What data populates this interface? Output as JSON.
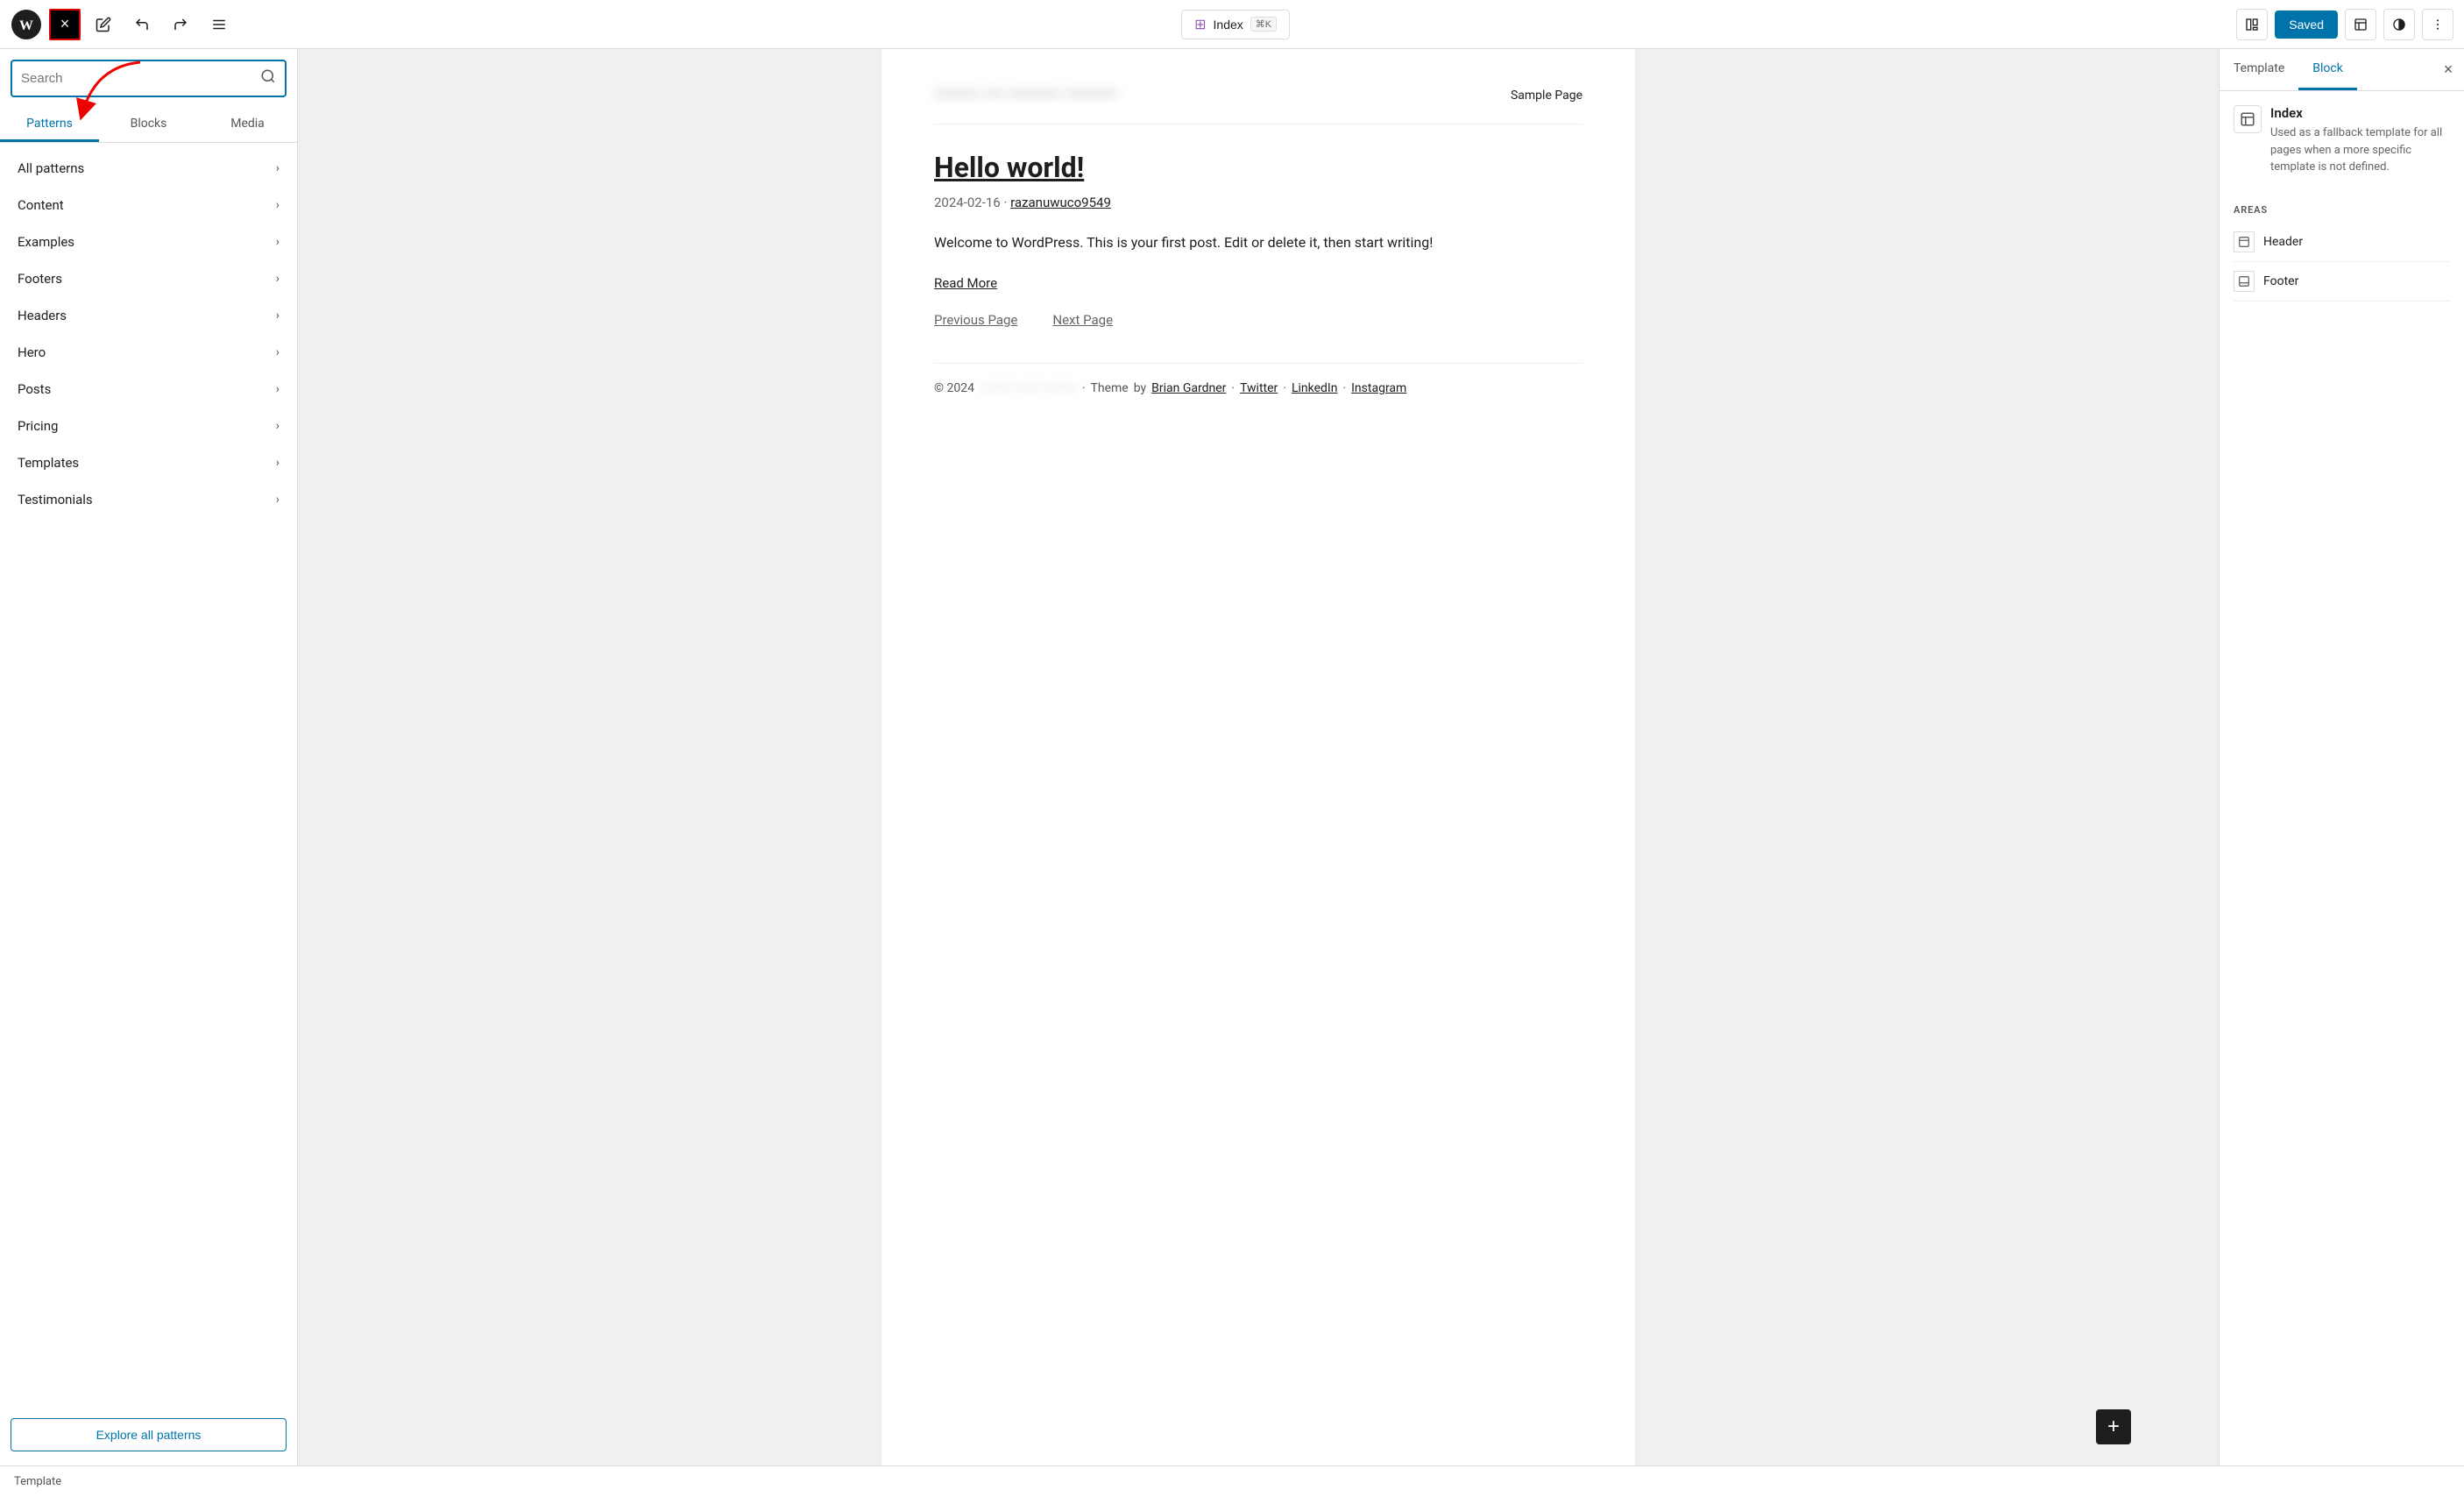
{
  "toolbar": {
    "close_label": "×",
    "command_palette_label": "Index",
    "command_palette_shortcut": "⌘K",
    "saved_label": "Saved",
    "undo_icon": "↩",
    "redo_icon": "↪",
    "list_view_icon": "≡"
  },
  "sidebar": {
    "search_placeholder": "Search",
    "tabs": [
      {
        "id": "patterns",
        "label": "Patterns"
      },
      {
        "id": "blocks",
        "label": "Blocks"
      },
      {
        "id": "media",
        "label": "Media"
      }
    ],
    "pattern_items": [
      {
        "label": "All patterns"
      },
      {
        "label": "Content"
      },
      {
        "label": "Examples"
      },
      {
        "label": "Footers"
      },
      {
        "label": "Headers"
      },
      {
        "label": "Hero"
      },
      {
        "label": "Posts"
      },
      {
        "label": "Pricing"
      },
      {
        "label": "Templates"
      },
      {
        "label": "Testimonials"
      }
    ],
    "explore_label": "Explore all patterns"
  },
  "content": {
    "page_header_blurred": "••••••••• ••• ••••••••• •••••••",
    "sample_page_label": "Sample Page",
    "post_title": "Hello world!",
    "post_meta_date": "2024-02-16",
    "post_meta_author": "razanuwuco9549",
    "post_body": "Welcome to WordPress. This is your first post. Edit or delete it, then start writing!",
    "read_more_label": "Read More",
    "prev_page_label": "Previous Page",
    "next_page_label": "Next Page",
    "footer_year": "© 2024",
    "footer_blurred": "••••••••• ••••••••• •••••••••",
    "footer_theme_label": "Theme",
    "footer_by": "by",
    "footer_author": "Brian Gardner",
    "footer_links": [
      "Twitter",
      "LinkedIn",
      "Instagram"
    ]
  },
  "right_panel": {
    "tabs": [
      {
        "id": "template",
        "label": "Template"
      },
      {
        "id": "block",
        "label": "Block"
      }
    ],
    "template_name": "Index",
    "template_desc": "Used as a fallback template for all pages when a more specific template is not defined.",
    "areas_label": "AREAS",
    "areas": [
      {
        "label": "Header"
      },
      {
        "label": "Footer"
      }
    ]
  },
  "status_bar": {
    "label": "Template"
  }
}
